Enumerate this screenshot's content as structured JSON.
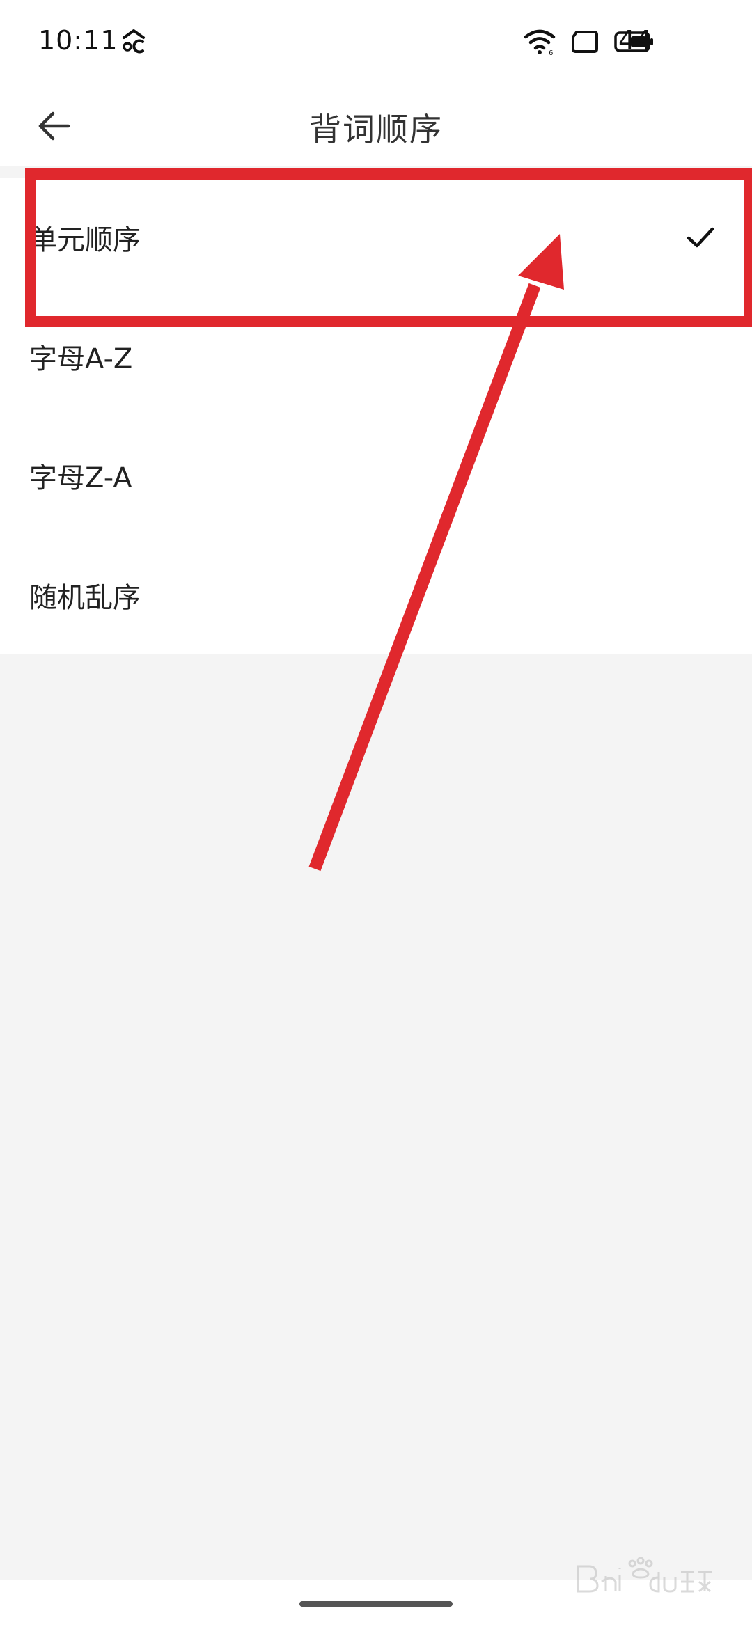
{
  "status_bar": {
    "time": "10:11",
    "battery_level": "44",
    "icons": [
      "app-notification-icon",
      "wifi-icon",
      "screen-icon",
      "battery-icon"
    ]
  },
  "header": {
    "title": "背词顺序",
    "back_icon": "arrow-left-icon"
  },
  "order_options": [
    {
      "label": "单元顺序",
      "selected": true
    },
    {
      "label": "字母A-Z",
      "selected": false
    },
    {
      "label": "字母Z-A",
      "selected": false
    },
    {
      "label": "随机乱序",
      "selected": false
    }
  ],
  "annotation": {
    "color": "#e0282d"
  },
  "colors": {
    "background": "#f4f4f4",
    "surface": "#ffffff",
    "text": "#222222"
  }
}
